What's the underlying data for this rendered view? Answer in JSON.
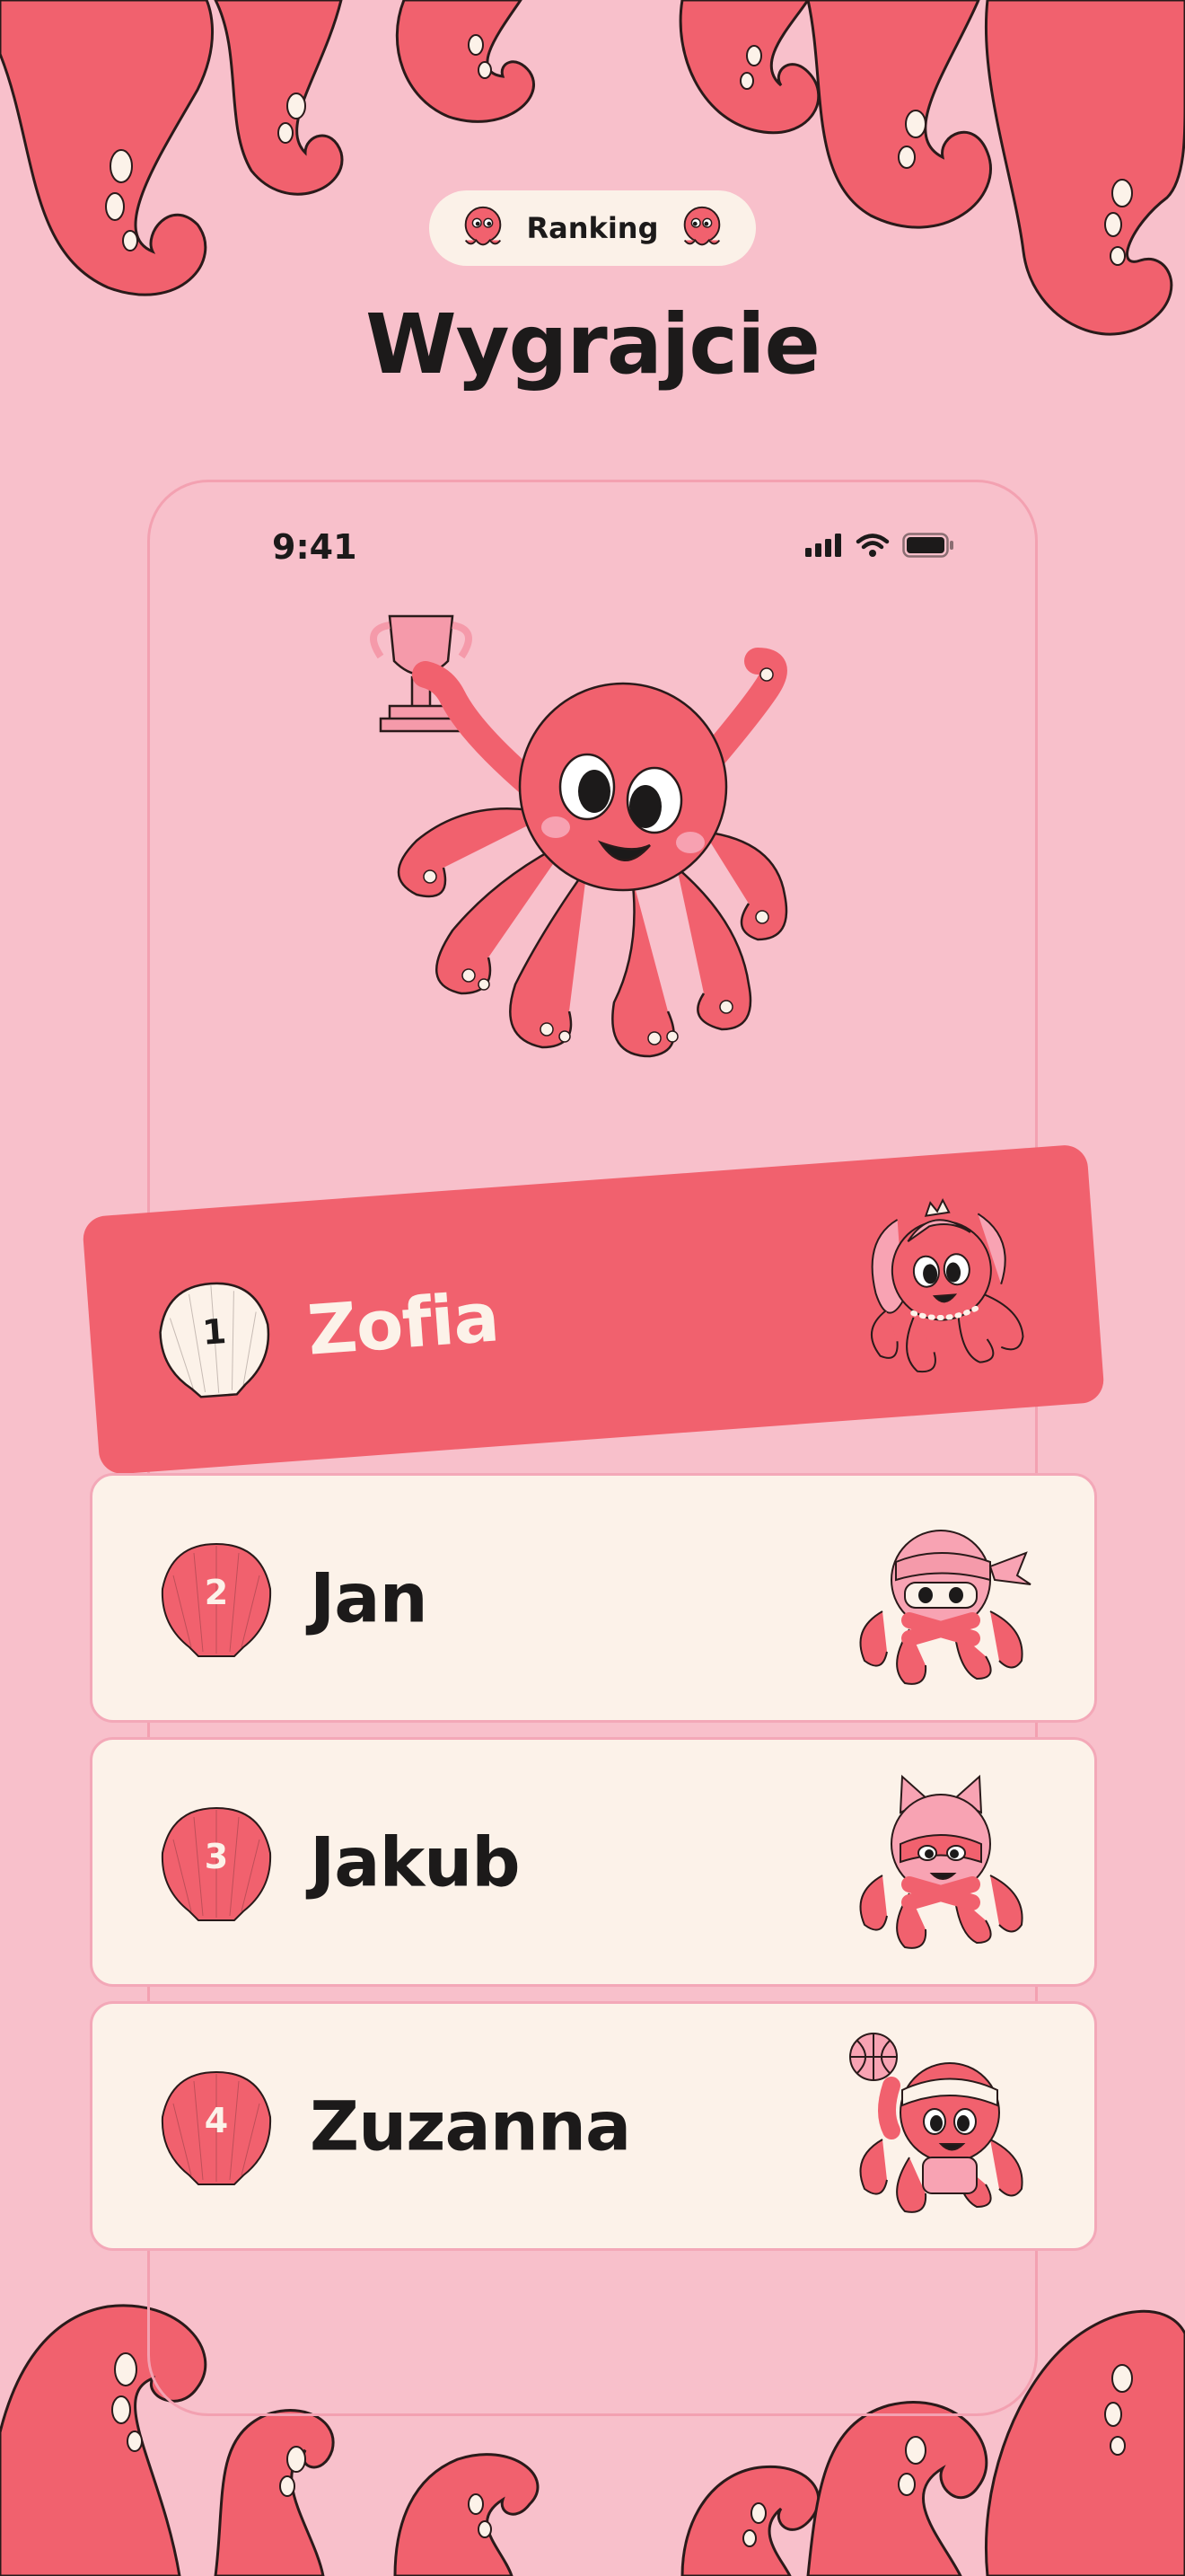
{
  "header": {
    "badge_label": "Ranking",
    "badge_icon": "octopus-icon",
    "title": "Wygrajcie"
  },
  "status_bar": {
    "time": "9:41",
    "icons": [
      "signal-icon",
      "wifi-icon",
      "battery-icon"
    ]
  },
  "hero": {
    "icon": "octopus-trophy-icon"
  },
  "ranking": [
    {
      "rank": "1",
      "name": "Zofia",
      "avatar": "octopus-princess-avatar",
      "highlighted": true
    },
    {
      "rank": "2",
      "name": "Jan",
      "avatar": "octopus-ninja-avatar",
      "highlighted": false
    },
    {
      "rank": "3",
      "name": "Jakub",
      "avatar": "octopus-cat-avatar",
      "highlighted": false
    },
    {
      "rank": "4",
      "name": "Zuzanna",
      "avatar": "octopus-basketball-avatar",
      "highlighted": false
    }
  ],
  "colors": {
    "background": "#f8c0cb",
    "accent": "#f1616e",
    "card": "#fcf2e9",
    "text": "#1c1a1a"
  }
}
